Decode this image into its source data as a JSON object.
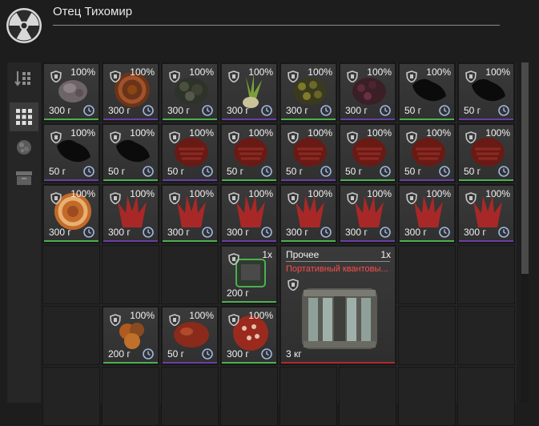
{
  "header": {
    "title": "Отец Тихомир",
    "logo_icon": "radiation-icon"
  },
  "sidebar": {
    "items": [
      {
        "name": "sort",
        "icon": "sort-icon",
        "active": false
      },
      {
        "name": "grid",
        "icon": "grid-icon",
        "active": true
      },
      {
        "name": "artifacts",
        "icon": "artifact-icon",
        "active": false
      },
      {
        "name": "storage",
        "icon": "box-icon",
        "active": false
      }
    ]
  },
  "colors": {
    "green": "#4caf50",
    "red": "#b12a2a",
    "purple": "#6a3fa2",
    "gray": "#6a6a6a"
  },
  "grid": {
    "items": [
      {
        "pct": "100%",
        "weight": "300 г",
        "art": "gray"
      },
      {
        "pct": "100%",
        "weight": "300 г",
        "art": "sausage"
      },
      {
        "pct": "100%",
        "weight": "300 г",
        "art": "dark"
      },
      {
        "pct": "100%",
        "weight": "300 г",
        "art": "leaf"
      },
      {
        "pct": "100%",
        "weight": "300 г",
        "art": "olive"
      },
      {
        "pct": "100%",
        "weight": "300 г",
        "art": "berry"
      },
      {
        "pct": "100%",
        "weight": "50 г",
        "art": "black"
      },
      {
        "pct": "100%",
        "weight": "50 г",
        "art": "black"
      },
      {
        "pct": "100%",
        "weight": "50 г",
        "art": "black"
      },
      {
        "pct": "100%",
        "weight": "50 г",
        "art": "black"
      },
      {
        "pct": "100%",
        "weight": "50 г",
        "art": "meat"
      },
      {
        "pct": "100%",
        "weight": "50 г",
        "art": "meat"
      },
      {
        "pct": "100%",
        "weight": "50 г",
        "art": "meat"
      },
      {
        "pct": "100%",
        "weight": "50 г",
        "art": "meat"
      },
      {
        "pct": "100%",
        "weight": "50 г",
        "art": "meat"
      },
      {
        "pct": "100%",
        "weight": "50 г",
        "art": "meat"
      },
      {
        "pct": "100%",
        "weight": "300 г",
        "art": "orange"
      },
      {
        "pct": "100%",
        "weight": "300 г",
        "art": "red"
      },
      {
        "pct": "100%",
        "weight": "300 г",
        "art": "red"
      },
      {
        "pct": "100%",
        "weight": "300 г",
        "art": "red"
      },
      {
        "pct": "100%",
        "weight": "300 г",
        "art": "red"
      },
      {
        "pct": "100%",
        "weight": "300 г",
        "art": "red"
      },
      {
        "pct": "100%",
        "weight": "300 г",
        "art": "red"
      },
      {
        "pct": "100%",
        "weight": "300 г",
        "art": "red"
      },
      {
        "qty": "1x",
        "weight": "200 г",
        "art": "device"
      },
      {
        "pct": "100%",
        "weight": "200 г",
        "art": "fruit"
      },
      {
        "pct": "100%",
        "weight": "50 г",
        "art": "meat2"
      },
      {
        "pct": "100%",
        "weight": "300 г",
        "art": "salami"
      }
    ],
    "card": {
      "category": "Прочее",
      "qty": "1x",
      "name": "Портативный квантовы...",
      "weight": "3 кг"
    }
  }
}
